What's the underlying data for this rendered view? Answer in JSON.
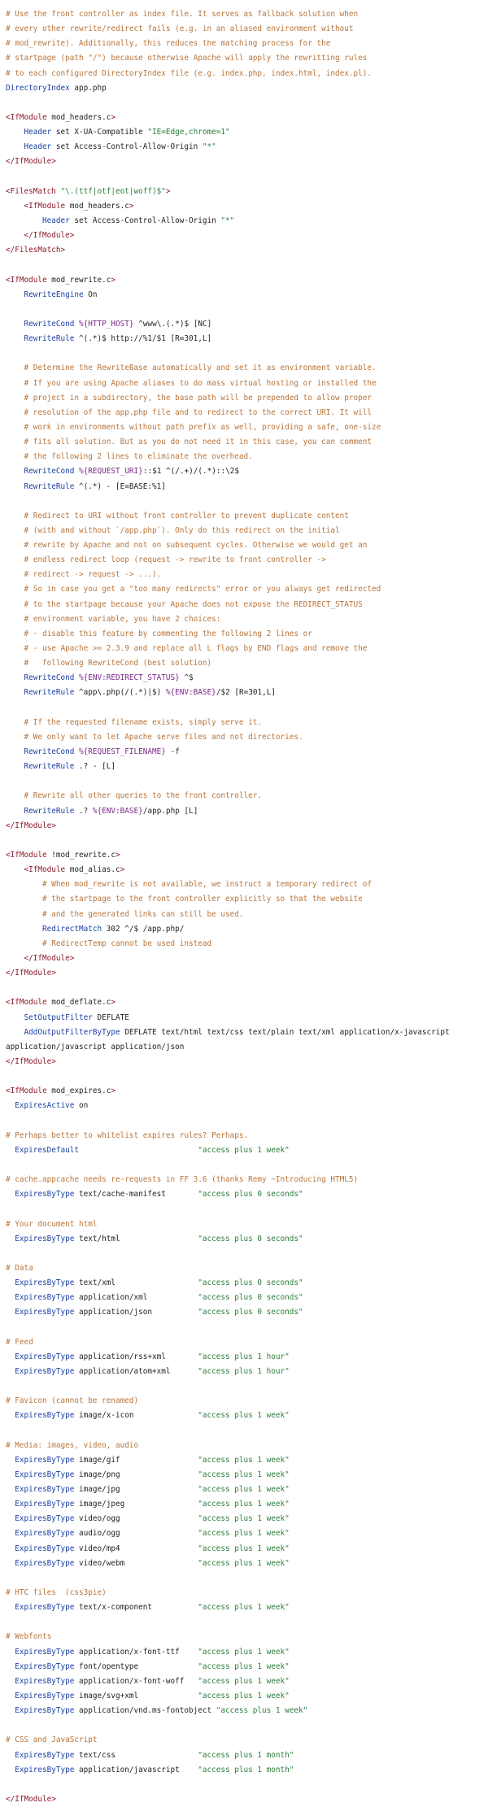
{
  "lines": [
    [
      [
        "c",
        "# Use the front controller as index file. It serves as fallback solution when"
      ]
    ],
    [
      [
        "c",
        "# every other rewrite/redirect fails (e.g. in an aliased environment without"
      ]
    ],
    [
      [
        "c",
        "# mod_rewrite). Additionally, this reduces the matching process for the"
      ]
    ],
    [
      [
        "c",
        "# startpage (path \"/\") because otherwise Apache will apply the rewritting rules"
      ]
    ],
    [
      [
        "c",
        "# to each configured DirectoryIndex file (e.g. index.php, index.html, index.pl)."
      ]
    ],
    [
      [
        "k",
        "DirectoryIndex"
      ],
      [
        "p",
        " app.php"
      ]
    ],
    [],
    [
      [
        "t",
        "<IfModule"
      ],
      [
        "p",
        " mod_headers.c"
      ],
      [
        "t",
        ">"
      ]
    ],
    [
      [
        "p",
        "    "
      ],
      [
        "k",
        "Header"
      ],
      [
        "p",
        " set X-UA-Compatible "
      ],
      [
        "s",
        "\"IE=Edge,chrome=1\""
      ]
    ],
    [
      [
        "p",
        "    "
      ],
      [
        "k",
        "Header"
      ],
      [
        "p",
        " set Access-Control-Allow-Origin "
      ],
      [
        "s",
        "\"*\""
      ]
    ],
    [
      [
        "t",
        "</IfModule>"
      ]
    ],
    [],
    [
      [
        "t",
        "<FilesMatch"
      ],
      [
        "p",
        " "
      ],
      [
        "s",
        "\"\\.(ttf|otf|eot|woff)$\""
      ],
      [
        "t",
        ">"
      ]
    ],
    [
      [
        "p",
        "    "
      ],
      [
        "t",
        "<IfModule"
      ],
      [
        "p",
        " mod_headers.c"
      ],
      [
        "t",
        ">"
      ]
    ],
    [
      [
        "p",
        "        "
      ],
      [
        "k",
        "Header"
      ],
      [
        "p",
        " set Access-Control-Allow-Origin "
      ],
      [
        "s",
        "\"*\""
      ]
    ],
    [
      [
        "p",
        "    "
      ],
      [
        "t",
        "</IfModule>"
      ]
    ],
    [
      [
        "t",
        "</FilesMatch>"
      ]
    ],
    [],
    [
      [
        "t",
        "<IfModule"
      ],
      [
        "p",
        " mod_rewrite.c"
      ],
      [
        "t",
        ">"
      ]
    ],
    [
      [
        "p",
        "    "
      ],
      [
        "k",
        "RewriteEngine"
      ],
      [
        "p",
        " On"
      ]
    ],
    [],
    [
      [
        "p",
        "    "
      ],
      [
        "k",
        "RewriteCond"
      ],
      [
        "p",
        " "
      ],
      [
        "v",
        "%{HTTP_HOST}"
      ],
      [
        "p",
        " ^www\\.(.*)$ [NC]"
      ]
    ],
    [
      [
        "p",
        "    "
      ],
      [
        "k",
        "RewriteRule"
      ],
      [
        "p",
        " ^(.*)$ http://%1/$1 [R=301,L]"
      ]
    ],
    [],
    [
      [
        "p",
        "    "
      ],
      [
        "c",
        "# Determine the RewriteBase automatically and set it as environment variable."
      ]
    ],
    [
      [
        "p",
        "    "
      ],
      [
        "c",
        "# If you are using Apache aliases to do mass virtual hosting or installed the"
      ]
    ],
    [
      [
        "p",
        "    "
      ],
      [
        "c",
        "# project in a subdirectory, the base path will be prepended to allow proper"
      ]
    ],
    [
      [
        "p",
        "    "
      ],
      [
        "c",
        "# resolution of the app.php file and to redirect to the correct URI. It will"
      ]
    ],
    [
      [
        "p",
        "    "
      ],
      [
        "c",
        "# work in environments without path prefix as well, providing a safe, one-size"
      ]
    ],
    [
      [
        "p",
        "    "
      ],
      [
        "c",
        "# fits all solution. But as you do not need it in this case, you can comment"
      ]
    ],
    [
      [
        "p",
        "    "
      ],
      [
        "c",
        "# the following 2 lines to eliminate the overhead."
      ]
    ],
    [
      [
        "p",
        "    "
      ],
      [
        "k",
        "RewriteCond"
      ],
      [
        "p",
        " "
      ],
      [
        "v",
        "%{REQUEST_URI}"
      ],
      [
        "p",
        "::$1 ^(/.+)/(.*)::\\2$"
      ]
    ],
    [
      [
        "p",
        "    "
      ],
      [
        "k",
        "RewriteRule"
      ],
      [
        "p",
        " ^(.*) - [E=BASE:%1]"
      ]
    ],
    [],
    [
      [
        "p",
        "    "
      ],
      [
        "c",
        "# Redirect to URI without front controller to prevent duplicate content"
      ]
    ],
    [
      [
        "p",
        "    "
      ],
      [
        "c",
        "# (with and without `/app.php`). Only do this redirect on the initial"
      ]
    ],
    [
      [
        "p",
        "    "
      ],
      [
        "c",
        "# rewrite by Apache and not on subsequent cycles. Otherwise we would get an"
      ]
    ],
    [
      [
        "p",
        "    "
      ],
      [
        "c",
        "# endless redirect loop (request -> rewrite to front controller ->"
      ]
    ],
    [
      [
        "p",
        "    "
      ],
      [
        "c",
        "# redirect -> request -> ...)."
      ]
    ],
    [
      [
        "p",
        "    "
      ],
      [
        "c",
        "# So in case you get a \"too many redirects\" error or you always get redirected"
      ]
    ],
    [
      [
        "p",
        "    "
      ],
      [
        "c",
        "# to the startpage because your Apache does not expose the REDIRECT_STATUS"
      ]
    ],
    [
      [
        "p",
        "    "
      ],
      [
        "c",
        "# environment variable, you have 2 choices:"
      ]
    ],
    [
      [
        "p",
        "    "
      ],
      [
        "c",
        "# - disable this feature by commenting the following 2 lines or"
      ]
    ],
    [
      [
        "p",
        "    "
      ],
      [
        "c",
        "# - use Apache >= 2.3.9 and replace all L flags by END flags and remove the"
      ]
    ],
    [
      [
        "p",
        "    "
      ],
      [
        "c",
        "#   following RewriteCond (best solution)"
      ]
    ],
    [
      [
        "p",
        "    "
      ],
      [
        "k",
        "RewriteCond"
      ],
      [
        "p",
        " "
      ],
      [
        "v",
        "%{ENV:REDIRECT_STATUS}"
      ],
      [
        "p",
        " ^$"
      ]
    ],
    [
      [
        "p",
        "    "
      ],
      [
        "k",
        "RewriteRule"
      ],
      [
        "p",
        " ^app\\.php(/(.*)|$) "
      ],
      [
        "v",
        "%{ENV:BASE}"
      ],
      [
        "p",
        "/$2 [R=301,L]"
      ]
    ],
    [],
    [
      [
        "p",
        "    "
      ],
      [
        "c",
        "# If the requested filename exists, simply serve it."
      ]
    ],
    [
      [
        "p",
        "    "
      ],
      [
        "c",
        "# We only want to let Apache serve files and not directories."
      ]
    ],
    [
      [
        "p",
        "    "
      ],
      [
        "k",
        "RewriteCond"
      ],
      [
        "p",
        " "
      ],
      [
        "v",
        "%{REQUEST_FILENAME}"
      ],
      [
        "p",
        " -f"
      ]
    ],
    [
      [
        "p",
        "    "
      ],
      [
        "k",
        "RewriteRule"
      ],
      [
        "p",
        " .? - [L]"
      ]
    ],
    [],
    [
      [
        "p",
        "    "
      ],
      [
        "c",
        "# Rewrite all other queries to the front controller."
      ]
    ],
    [
      [
        "p",
        "    "
      ],
      [
        "k",
        "RewriteRule"
      ],
      [
        "p",
        " .? "
      ],
      [
        "v",
        "%{ENV:BASE}"
      ],
      [
        "p",
        "/app.php [L]"
      ]
    ],
    [
      [
        "t",
        "</IfModule>"
      ]
    ],
    [],
    [
      [
        "t",
        "<IfModule"
      ],
      [
        "p",
        " !mod_rewrite.c"
      ],
      [
        "t",
        ">"
      ]
    ],
    [
      [
        "p",
        "    "
      ],
      [
        "t",
        "<IfModule"
      ],
      [
        "p",
        " mod_alias.c"
      ],
      [
        "t",
        ">"
      ]
    ],
    [
      [
        "p",
        "        "
      ],
      [
        "c",
        "# When mod_rewrite is not available, we instruct a temporary redirect of"
      ]
    ],
    [
      [
        "p",
        "        "
      ],
      [
        "c",
        "# the startpage to the front controller explicitly so that the website"
      ]
    ],
    [
      [
        "p",
        "        "
      ],
      [
        "c",
        "# and the generated links can still be used."
      ]
    ],
    [
      [
        "p",
        "        "
      ],
      [
        "k",
        "RedirectMatch"
      ],
      [
        "p",
        " 302 ^/$ /app.php/"
      ]
    ],
    [
      [
        "p",
        "        "
      ],
      [
        "c",
        "# RedirectTemp cannot be used instead"
      ]
    ],
    [
      [
        "p",
        "    "
      ],
      [
        "t",
        "</IfModule>"
      ]
    ],
    [
      [
        "t",
        "</IfModule>"
      ]
    ],
    [],
    [
      [
        "t",
        "<IfModule"
      ],
      [
        "p",
        " mod_deflate.c"
      ],
      [
        "t",
        ">"
      ]
    ],
    [
      [
        "p",
        "    "
      ],
      [
        "k",
        "SetOutputFilter"
      ],
      [
        "p",
        " DEFLATE"
      ]
    ],
    [
      [
        "p",
        "    "
      ],
      [
        "k",
        "AddOutputFilterByType"
      ],
      [
        "p",
        " DEFLATE text/html text/css text/plain text/xml application/x-javascript"
      ]
    ],
    [
      [
        "p",
        "application/javascript application/json"
      ]
    ],
    [
      [
        "t",
        "</IfModule>"
      ]
    ],
    [],
    [
      [
        "t",
        "<IfModule"
      ],
      [
        "p",
        " mod_expires.c"
      ],
      [
        "t",
        ">"
      ]
    ],
    [
      [
        "p",
        "  "
      ],
      [
        "k",
        "ExpiresActive"
      ],
      [
        "p",
        " on"
      ]
    ],
    [],
    [
      [
        "c",
        "# Perhaps better to whitelist expires rules? Perhaps."
      ]
    ],
    [
      [
        "p",
        "  "
      ],
      [
        "k",
        "ExpiresDefault"
      ],
      [
        "p",
        "                          "
      ],
      [
        "s",
        "\"access plus 1 week\""
      ]
    ],
    [],
    [
      [
        "c",
        "# cache.appcache needs re-requests in FF 3.6 (thanks Remy ~Introducing HTML5)"
      ]
    ],
    [
      [
        "p",
        "  "
      ],
      [
        "k",
        "ExpiresByType"
      ],
      [
        "p",
        " text/cache-manifest       "
      ],
      [
        "s",
        "\"access plus 0 seconds\""
      ]
    ],
    [],
    [
      [
        "c",
        "# Your document html"
      ]
    ],
    [
      [
        "p",
        "  "
      ],
      [
        "k",
        "ExpiresByType"
      ],
      [
        "p",
        " text/html                 "
      ],
      [
        "s",
        "\"access plus 0 seconds\""
      ]
    ],
    [],
    [
      [
        "c",
        "# Data"
      ]
    ],
    [
      [
        "p",
        "  "
      ],
      [
        "k",
        "ExpiresByType"
      ],
      [
        "p",
        " text/xml                  "
      ],
      [
        "s",
        "\"access plus 0 seconds\""
      ]
    ],
    [
      [
        "p",
        "  "
      ],
      [
        "k",
        "ExpiresByType"
      ],
      [
        "p",
        " application/xml           "
      ],
      [
        "s",
        "\"access plus 0 seconds\""
      ]
    ],
    [
      [
        "p",
        "  "
      ],
      [
        "k",
        "ExpiresByType"
      ],
      [
        "p",
        " application/json          "
      ],
      [
        "s",
        "\"access plus 0 seconds\""
      ]
    ],
    [],
    [
      [
        "c",
        "# Feed"
      ]
    ],
    [
      [
        "p",
        "  "
      ],
      [
        "k",
        "ExpiresByType"
      ],
      [
        "p",
        " application/rss+xml       "
      ],
      [
        "s",
        "\"access plus 1 hour\""
      ]
    ],
    [
      [
        "p",
        "  "
      ],
      [
        "k",
        "ExpiresByType"
      ],
      [
        "p",
        " application/atom+xml      "
      ],
      [
        "s",
        "\"access plus 1 hour\""
      ]
    ],
    [],
    [
      [
        "c",
        "# Favicon (cannot be renamed)"
      ]
    ],
    [
      [
        "p",
        "  "
      ],
      [
        "k",
        "ExpiresByType"
      ],
      [
        "p",
        " image/x-icon              "
      ],
      [
        "s",
        "\"access plus 1 week\""
      ]
    ],
    [],
    [
      [
        "c",
        "# Media: images, video, audio"
      ]
    ],
    [
      [
        "p",
        "  "
      ],
      [
        "k",
        "ExpiresByType"
      ],
      [
        "p",
        " image/gif                 "
      ],
      [
        "s",
        "\"access plus 1 week\""
      ]
    ],
    [
      [
        "p",
        "  "
      ],
      [
        "k",
        "ExpiresByType"
      ],
      [
        "p",
        " image/png                 "
      ],
      [
        "s",
        "\"access plus 1 week\""
      ]
    ],
    [
      [
        "p",
        "  "
      ],
      [
        "k",
        "ExpiresByType"
      ],
      [
        "p",
        " image/jpg                 "
      ],
      [
        "s",
        "\"access plus 1 week\""
      ]
    ],
    [
      [
        "p",
        "  "
      ],
      [
        "k",
        "ExpiresByType"
      ],
      [
        "p",
        " image/jpeg                "
      ],
      [
        "s",
        "\"access plus 1 week\""
      ]
    ],
    [
      [
        "p",
        "  "
      ],
      [
        "k",
        "ExpiresByType"
      ],
      [
        "p",
        " video/ogg                 "
      ],
      [
        "s",
        "\"access plus 1 week\""
      ]
    ],
    [
      [
        "p",
        "  "
      ],
      [
        "k",
        "ExpiresByType"
      ],
      [
        "p",
        " audio/ogg                 "
      ],
      [
        "s",
        "\"access plus 1 week\""
      ]
    ],
    [
      [
        "p",
        "  "
      ],
      [
        "k",
        "ExpiresByType"
      ],
      [
        "p",
        " video/mp4                 "
      ],
      [
        "s",
        "\"access plus 1 week\""
      ]
    ],
    [
      [
        "p",
        "  "
      ],
      [
        "k",
        "ExpiresByType"
      ],
      [
        "p",
        " video/webm                "
      ],
      [
        "s",
        "\"access plus 1 week\""
      ]
    ],
    [],
    [
      [
        "c",
        "# HTC files  (css3pie)"
      ]
    ],
    [
      [
        "p",
        "  "
      ],
      [
        "k",
        "ExpiresByType"
      ],
      [
        "p",
        " text/x-component          "
      ],
      [
        "s",
        "\"access plus 1 week\""
      ]
    ],
    [],
    [
      [
        "c",
        "# Webfonts"
      ]
    ],
    [
      [
        "p",
        "  "
      ],
      [
        "k",
        "ExpiresByType"
      ],
      [
        "p",
        " application/x-font-ttf    "
      ],
      [
        "s",
        "\"access plus 1 week\""
      ]
    ],
    [
      [
        "p",
        "  "
      ],
      [
        "k",
        "ExpiresByType"
      ],
      [
        "p",
        " font/opentype             "
      ],
      [
        "s",
        "\"access plus 1 week\""
      ]
    ],
    [
      [
        "p",
        "  "
      ],
      [
        "k",
        "ExpiresByType"
      ],
      [
        "p",
        " application/x-font-woff   "
      ],
      [
        "s",
        "\"access plus 1 week\""
      ]
    ],
    [
      [
        "p",
        "  "
      ],
      [
        "k",
        "ExpiresByType"
      ],
      [
        "p",
        " image/svg+xml             "
      ],
      [
        "s",
        "\"access plus 1 week\""
      ]
    ],
    [
      [
        "p",
        "  "
      ],
      [
        "k",
        "ExpiresByType"
      ],
      [
        "p",
        " application/vnd.ms-fontobject "
      ],
      [
        "s",
        "\"access plus 1 week\""
      ]
    ],
    [],
    [
      [
        "c",
        "# CSS and JavaScript"
      ]
    ],
    [
      [
        "p",
        "  "
      ],
      [
        "k",
        "ExpiresByType"
      ],
      [
        "p",
        " text/css                  "
      ],
      [
        "s",
        "\"access plus 1 month\""
      ]
    ],
    [
      [
        "p",
        "  "
      ],
      [
        "k",
        "ExpiresByType"
      ],
      [
        "p",
        " application/javascript    "
      ],
      [
        "s",
        "\"access plus 1 month\""
      ]
    ],
    [],
    [
      [
        "t",
        "</IfModule>"
      ]
    ]
  ]
}
